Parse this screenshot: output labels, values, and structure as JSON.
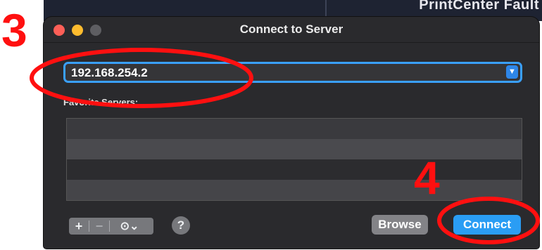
{
  "backdrop": {
    "text": "PrintCenter Fault"
  },
  "window": {
    "title": "Connect to Server"
  },
  "address": {
    "value": "192.168.254.2",
    "dropdown_icon": "chevron-down-icon"
  },
  "favorites": {
    "label": "Favorite Servers:",
    "rows": [
      "",
      "",
      "",
      ""
    ]
  },
  "toolbar": {
    "add": "+",
    "remove": "−",
    "action": "⊙⌄",
    "help": "?"
  },
  "buttons": {
    "browse": "Browse",
    "connect": "Connect"
  },
  "annotations": {
    "step3": "3",
    "step4": "4",
    "color": "#ff1010"
  }
}
